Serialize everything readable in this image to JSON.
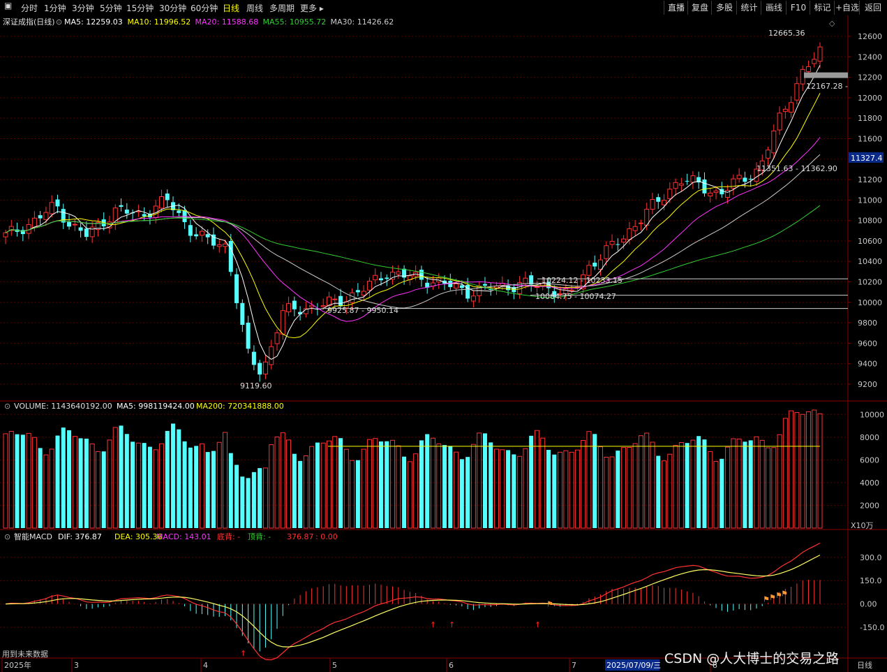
{
  "toolbar": {
    "periods": [
      "分时",
      "1分钟",
      "3分钟",
      "5分钟",
      "15分钟",
      "30分钟",
      "60分钟",
      "日线",
      "周线",
      "多周期",
      "更多"
    ],
    "active_period": "日线",
    "right_buttons": [
      "直播",
      "复盘",
      "多股",
      "统计",
      "画线",
      "F10",
      "标记",
      "+自选",
      "返回"
    ]
  },
  "main": {
    "title": "深证成指(日线)",
    "indicators": [
      {
        "name": "MA5",
        "value": "12259.03",
        "color": "#ffffff"
      },
      {
        "name": "MA10",
        "value": "11996.52",
        "color": "#ffff00"
      },
      {
        "name": "MA20",
        "value": "11588.68",
        "color": "#ff33ff"
      },
      {
        "name": "MA55",
        "value": "10955.72",
        "color": "#33cc33"
      },
      {
        "name": "MA30",
        "value": "11426.62",
        "color": "#cccccc"
      }
    ],
    "current_price_label": "11327.4",
    "annotations": {
      "high": "12665.36",
      "low": "9119.60",
      "gap1": "12167.28 -",
      "gap2": "11351.63 - 11362.90",
      "gap3": "10224.12 - 10233.15",
      "gap4": "10064.75 - 10074.27",
      "gap5": "9925.87 - 9950.14"
    },
    "yticks": [
      "12600",
      "12400",
      "12200",
      "12000",
      "11800",
      "11600",
      "11400",
      "11200",
      "11000",
      "10800",
      "10600",
      "10400",
      "10200",
      "10000",
      "9800",
      "9600",
      "9400",
      "9200"
    ]
  },
  "volume": {
    "label": "VOLUME",
    "value": "1143640192.00",
    "ma5": "998119424.00",
    "ma200": "720341888.00",
    "yticks": [
      "10000",
      "8000",
      "6000",
      "4000",
      "2000"
    ],
    "unit": "X10万"
  },
  "macd": {
    "title": "智能MACD",
    "dif": "376.87",
    "dea": "305.36",
    "macd": "143.01",
    "bottom_div": "底背: -",
    "top_div": "顶背: -",
    "extra": "376.87",
    "extra2": ": 0.00",
    "yticks": [
      "300.0",
      "150.0",
      "0.00",
      "-150.0"
    ],
    "note": "用到未来数据"
  },
  "xaxis": {
    "labels": [
      "2025年",
      "3",
      "4",
      "5",
      "6",
      "7",
      "8"
    ],
    "cursor_date": "2025/07/09/三",
    "period": "日线"
  },
  "watermark": "CSDN @人大博士的交易之路",
  "colors": {
    "up": "#ff3232",
    "down": "#54ffff",
    "ma5": "#ffffff",
    "ma10": "#ffff00",
    "ma20": "#ff33ff",
    "ma30": "#cccccc",
    "ma55": "#33cc33",
    "grid": "#5a0000"
  }
}
